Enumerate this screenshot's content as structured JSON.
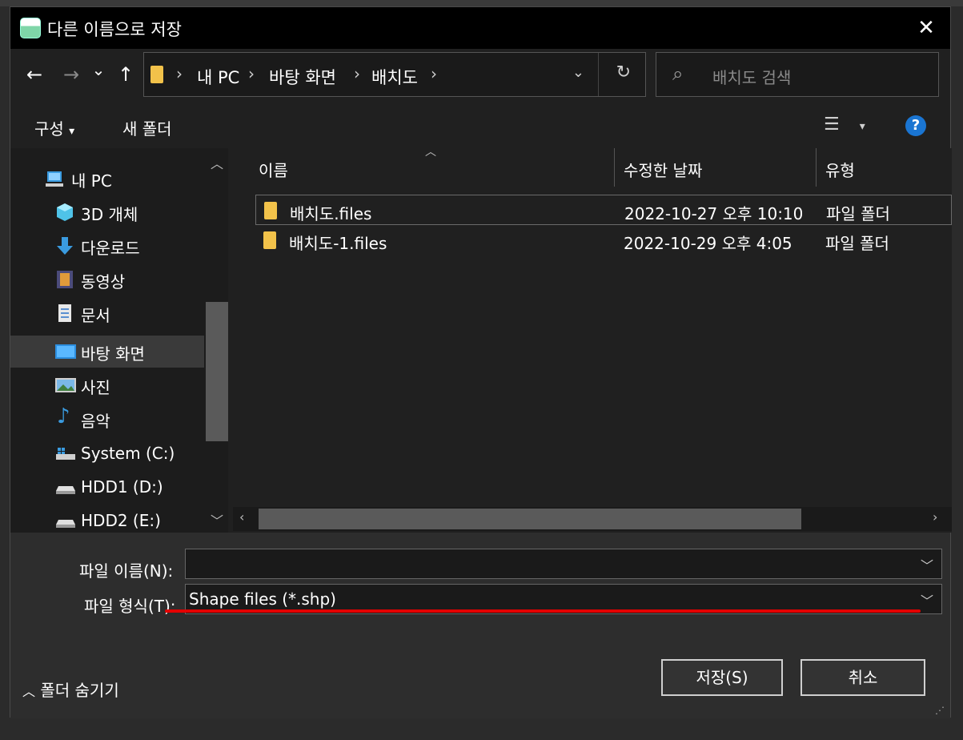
{
  "window": {
    "title": "다른 이름으로 저장",
    "close_glyph": "✕"
  },
  "nav": {
    "back": "←",
    "forward": "→",
    "recent": "⌄",
    "up": "↑",
    "breadcrumbs": [
      "내 PC",
      "바탕 화면",
      "배치도"
    ],
    "refresh": "↻",
    "dropdown": "⌄"
  },
  "search": {
    "placeholder": "배치도 검색"
  },
  "toolbar": {
    "organize": "구성",
    "organize_caret": "▾",
    "new_folder": "새 폴더",
    "view_caret": "▾",
    "help": "?"
  },
  "sidebar": {
    "items": [
      {
        "label": "내 PC",
        "icon": "computer-icon"
      },
      {
        "label": "3D 개체",
        "icon": "3d-objects-icon"
      },
      {
        "label": "다운로드",
        "icon": "download-icon"
      },
      {
        "label": "동영상",
        "icon": "video-icon"
      },
      {
        "label": "문서",
        "icon": "document-icon"
      },
      {
        "label": "바탕 화면",
        "icon": "desktop-icon",
        "selected": true
      },
      {
        "label": "사진",
        "icon": "pictures-icon"
      },
      {
        "label": "음악",
        "icon": "music-icon"
      },
      {
        "label": "System (C:)",
        "icon": "drive-icon"
      },
      {
        "label": "HDD1 (D:)",
        "icon": "drive-icon"
      },
      {
        "label": "HDD2 (E:)",
        "icon": "drive-icon"
      }
    ]
  },
  "files": {
    "columns": [
      "이름",
      "수정한 날짜",
      "유형"
    ],
    "rows": [
      {
        "name": "배치도.files",
        "modified": "2022-10-27 오후 10:10",
        "type": "파일 폴더"
      },
      {
        "name": "배치도-1.files",
        "modified": "2022-10-29 오후 4:05",
        "type": "파일 폴더"
      }
    ]
  },
  "form": {
    "filename_label": "파일 이름(N):",
    "filename_value": "",
    "filetype_label": "파일 형식(T):",
    "filetype_value": "Shape files (*.shp)"
  },
  "footer": {
    "hide_folders": "폴더 숨기기",
    "save": "저장(S)",
    "cancel": "취소"
  },
  "colors": {
    "annotation": "#e30000",
    "help": "#1a75d2",
    "folder": "#f2c24a"
  }
}
